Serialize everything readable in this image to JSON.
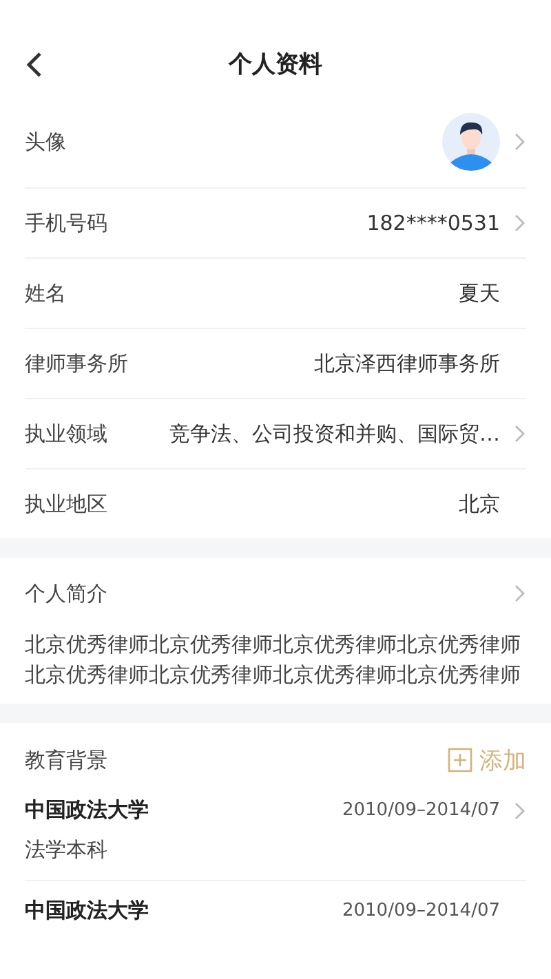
{
  "header": {
    "title": "个人资料"
  },
  "profile_rows": [
    {
      "kind": "avatar",
      "label": "头像",
      "arrow": true
    },
    {
      "kind": "text",
      "label": "手机号码",
      "value": "182****0531",
      "arrow": true
    },
    {
      "kind": "text",
      "label": "姓名",
      "value": "夏天",
      "arrow": false
    },
    {
      "kind": "text",
      "label": "律师事务所",
      "value": "北京泽西律师事务所",
      "arrow": false
    },
    {
      "kind": "text",
      "label": "执业领域",
      "value": "竞争法、公司投资和并购、国际贸…",
      "arrow": true
    },
    {
      "kind": "text",
      "label": "执业地区",
      "value": "北京",
      "arrow": false
    }
  ],
  "bio": {
    "label": "个人简介",
    "arrow": true,
    "text": "北京优秀律师北京优秀律师北京优秀律师北京优秀律师北京优秀律师北京优秀律师北京优秀律师北京优秀律师"
  },
  "education": {
    "label": "教育背景",
    "add_label": "添加",
    "items": [
      {
        "school": "中国政法大学",
        "period": "2010/09–2014/07",
        "degree": "法学本科",
        "arrow": true
      },
      {
        "school": "中国政法大学",
        "period": "2010/09–2014/07",
        "arrow": false
      }
    ]
  }
}
